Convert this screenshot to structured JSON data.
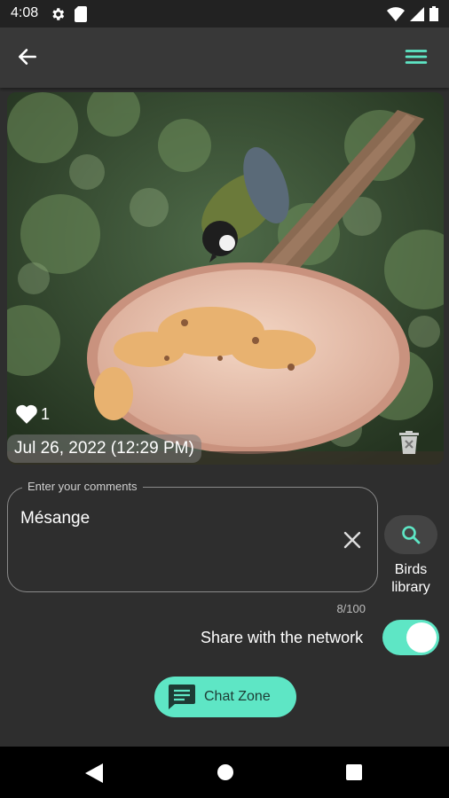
{
  "status_bar": {
    "time": "4:08",
    "left_icons": [
      "gear-icon",
      "sd-card-icon"
    ],
    "right_icons": [
      "wifi-icon",
      "signal-icon",
      "battery-icon"
    ]
  },
  "app_bar": {
    "back_icon": "arrow-left-icon",
    "menu_icon": "hamburger-menu-icon"
  },
  "photo": {
    "likes_count": "1",
    "date": "Jul 26, 2022 (12:29 PM)"
  },
  "comment": {
    "label": "Enter your comments",
    "value": "Mésange",
    "char_count": "8/100"
  },
  "birds_library": {
    "label": "Birds library"
  },
  "share": {
    "label": "Share with the network",
    "enabled": true
  },
  "chat": {
    "label": "Chat Zone"
  },
  "colors": {
    "accent": "#5ee6c5",
    "background": "#2e2e2e",
    "app_bar": "#383838"
  }
}
